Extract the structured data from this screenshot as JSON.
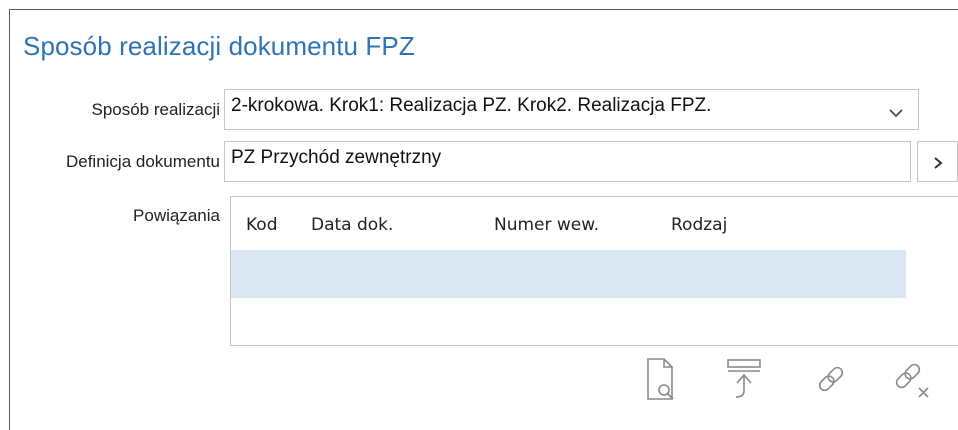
{
  "title": "Sposób realizacji dokumentu FPZ",
  "fields": {
    "sposob": {
      "label": "Sposób realizacji",
      "value": "2-krokowa. Krok1: Realizacja PZ. Krok2. Realizacja FPZ."
    },
    "definicja": {
      "label": "Definicja dokumentu",
      "value": "PZ Przychód zewnętrzny"
    },
    "powiazania": {
      "label": "Powiązania"
    }
  },
  "grid": {
    "columns": [
      "Kod",
      "Data dok.",
      "Numer wew.",
      "Rodzaj"
    ],
    "rows": []
  },
  "toolbar": {
    "icons": [
      "preview-document-icon",
      "upload-icon",
      "link-icon",
      "unlink-icon"
    ]
  },
  "colors": {
    "title": "#2e74b5",
    "selected_row": "#dbe7f3",
    "border": "#c6c6c6",
    "icon": "#8a8a8a"
  }
}
